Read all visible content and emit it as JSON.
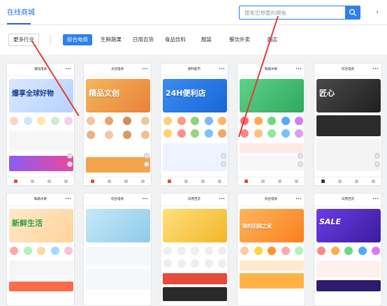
{
  "header": {
    "title": "在线商城",
    "search_placeholder": "搜索您想要的模板",
    "chevron": "›"
  },
  "filter": {
    "more_label": "更多行业",
    "categories": [
      "综合电商",
      "生鲜蔬果",
      "日用百货",
      "食品饮料",
      "服装",
      "餐饮外卖",
      "酒店"
    ],
    "active_index": 0
  },
  "templates": [
    {
      "title": "潮流电商",
      "banner": "爆享全球好物",
      "theme": "#c9dfff"
    },
    {
      "title": "文创电商",
      "banner": "精品文创",
      "theme": "#f3a64a"
    },
    {
      "title": "便利超市",
      "banner": "24H便利店",
      "theme": "#2f80ed"
    },
    {
      "title": "鲜蔬水果",
      "banner": "",
      "theme": "#41b86a"
    },
    {
      "title": "综合电商",
      "banner": "匠心",
      "theme": "#3a3a3a"
    },
    {
      "title": "鲜蔬水果",
      "banner": "新鲜生活",
      "theme": "#ffe8c8"
    },
    {
      "title": "综合电商",
      "banner": "",
      "theme": "#9fd4ef"
    },
    {
      "title": "日用百货",
      "banner": "",
      "theme": "#f2c94c"
    },
    {
      "title": "综合电商",
      "banner": "我的田园之家",
      "theme": "#fb8c2e"
    },
    {
      "title": "日用百货",
      "banner": "SALE",
      "theme": "#5b2dbd"
    }
  ],
  "colors": {
    "accent": "#2f80ed",
    "arrow": "#e53935"
  }
}
